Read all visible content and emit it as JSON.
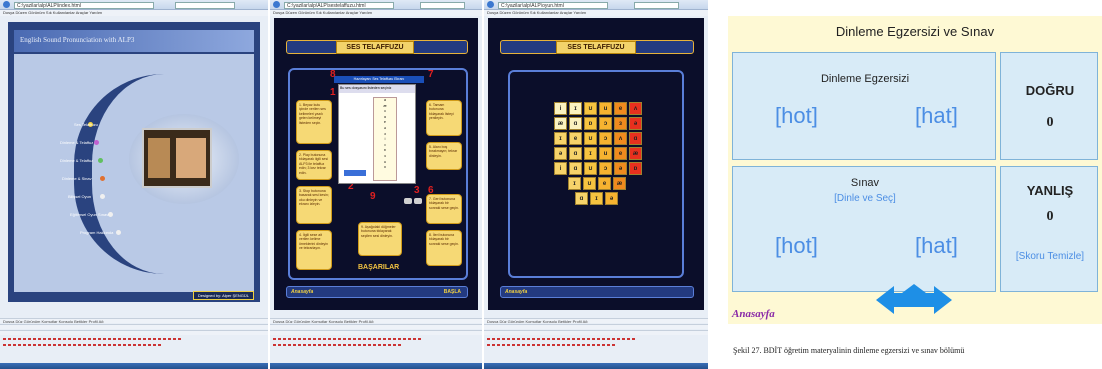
{
  "panel1": {
    "address": "C:\\yazilar\\alp\\ALP\\index.html",
    "menu": "Dosya  Düzen  Görünüm  Sık Kullanılanlar  Araçlar  Yardım",
    "banner": "English Sound Pronunciation with ALP3",
    "nav": [
      "Ses Telaffuzu",
      "Dinleme & Telaffuz",
      "Dinleme & Telaffuz",
      "Dinleme & Sinav",
      "Bilişsel Oyun",
      "Eğitimsel Oyun Sınavı",
      "Program Hakkında"
    ],
    "footer": "Designed by: Alper ŞENGÜL",
    "status_menu": "Dosya  Düz  Görünüm  Komutlar  Konsolu  Betikler  Profil  Ağ",
    "colors": {
      "bg": "#2d4a8c",
      "page": "#4c6bb0"
    }
  },
  "panel2": {
    "address": "C:\\yazilar\\alp\\ALP\\sestelaffuzu.html",
    "title": "SES TELAFFUZU",
    "header_strip": "Hazırlayan: Ses Telaffuzu Ekranı",
    "left_boxes": [
      "1. Beyaz kutu içinde verilen ses kelimeleri yazılı gelen kelimeyi listeden seçin.",
      "2. Play butonuna tıklayarak ilgili sesi ALP3 ile telaffuz edin; 3 kez tekrar edin.",
      "3. Stop butonuna basarak sesi kesin; oku dinleyin ve ekranı izleyin.",
      "4. İlgili sese ait verilen kelime örneklerini dinleyin ve tekrarlayın."
    ],
    "right_boxes": [
      "6. Tamam butonuna tıklayarak listeyi yenileyin.",
      "5. Alanı boş bırakmayın; tekrar dinleyin.",
      "7. Geri butonuna tıklayarak bir sonraki sese geçin.",
      "8. İleri butonuna tıklayarak bir sonraki sese geçin."
    ],
    "center_box": "9. Aşağıdaki düğmeler butonuna tıklayarak seçilen sesi dinleyin.",
    "popup_header": "Bu ses dosyasını listeden seçiniz",
    "list_items": [
      "a",
      "æ",
      "ʌ",
      "ɑ",
      "e",
      "ə",
      "ɜ",
      "i",
      "ɪ",
      "ɒ",
      "ɔ",
      "u",
      "ʊ"
    ],
    "numbers": [
      "8",
      "7",
      "1",
      "4",
      "2",
      "3",
      "6",
      "9",
      "5"
    ],
    "footer_logo": "Anasayfa",
    "footer_right": "BAŞLA",
    "achievement": "BAŞARILAR"
  },
  "panel3": {
    "address": "C:\\yazilar\\alp\\ALP\\oyun.html",
    "title": "SES TELAFFUZU",
    "grid": [
      [
        "i",
        "ɪ",
        "ʊ",
        "u",
        "e",
        "ʌ"
      ],
      [
        "æ",
        "ɑ",
        "ɒ",
        "ɔ",
        "ɜ",
        "ə"
      ],
      [
        "ɪ",
        "e",
        "ʊ",
        "ɔ",
        "ʌ",
        "ɑ"
      ],
      [
        "ə",
        "ɑ",
        "ɪ",
        "u",
        "e",
        "æ"
      ],
      [
        "i",
        "ɑ",
        "ʊ",
        "ɔ",
        "ə",
        "ɒ"
      ],
      [
        "ɪ",
        "ʊ",
        "e",
        "æ"
      ],
      [
        "ɑ",
        "ɪ",
        "ə"
      ]
    ],
    "footer_logo": "Anasayfa"
  },
  "panel4": {
    "title": "Dinleme Egzersizi ve Sınav",
    "exercise_label": "Dinleme Egzersizi",
    "word1": "[hot]",
    "word2": "[hat]",
    "exam_label": "Sınav",
    "exam_sub": "[Dinle ve Seç]",
    "exam_word1": "[hot]",
    "exam_word2": "[hat]",
    "correct_label": "DOĞRU",
    "correct_value": "0",
    "wrong_label": "YANLIŞ",
    "wrong_value": "0",
    "clear_button": "[Skoru Temizle]",
    "home_logo": "Anasayfa",
    "caption": "Şekil 27. BDİT öğretim materyalinin dinleme egzersizi ve sınav bölümü",
    "colors": {
      "bg": "#fef9d4",
      "box": "#d8ebf7",
      "accent": "#4c8ee4",
      "logo": "#8a2aa8"
    }
  }
}
